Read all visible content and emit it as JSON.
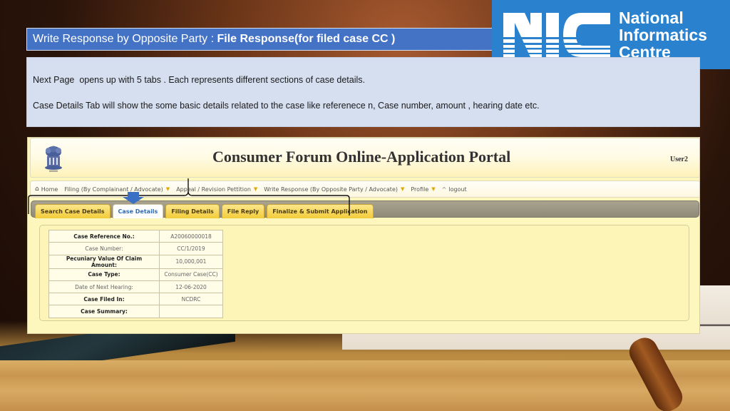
{
  "slide": {
    "title_prefix": "Write Response by Opposite Party : ",
    "title_bold": "File Response(for filed case CC )",
    "description": [
      "Next Page  opens up with 5 tabs . Each represents different sections of case details.",
      "Case Details Tab will show the some basic details related to the case like referenece n, Case number, amount , hearing date etc."
    ]
  },
  "logo": {
    "mark": "NIC",
    "lines": [
      "National",
      "Informatics",
      "Centre"
    ],
    "color": "#2a82cf"
  },
  "portal": {
    "title": "Consumer Forum Online-Application Portal",
    "user": "User2",
    "nav": [
      {
        "label": "Home",
        "icon": "home-icon",
        "dropdown": false
      },
      {
        "label": "Filing (By Complainant / Advocate)",
        "dropdown": true
      },
      {
        "label": "Appeal / Revision Pettition",
        "dropdown": true
      },
      {
        "label": "Write Response (By Opposite Party / Advocate)",
        "dropdown": true
      },
      {
        "label": "Profile",
        "dropdown": true
      },
      {
        "label": "logout",
        "icon": "logout-icon",
        "dropdown": false
      }
    ],
    "tabs": [
      {
        "label": "Search Case Details",
        "active": false
      },
      {
        "label": "Case Details",
        "active": true
      },
      {
        "label": "Filing Details",
        "active": false
      },
      {
        "label": "File Reply",
        "active": false
      },
      {
        "label": "Finalize & Submit Application",
        "active": false
      }
    ],
    "case_details": [
      {
        "label": "Case Reference No.:",
        "value": "A20060000018"
      },
      {
        "label": "Case Number:",
        "value": "CC/1/2019"
      },
      {
        "label": "Pecuniary Value Of Claim Amount:",
        "value": "10,000,001"
      },
      {
        "label": "Case Type:",
        "value": "Consumer Case(CC)"
      },
      {
        "label": "Date of Next Hearing:",
        "value": "12-06-2020"
      },
      {
        "label": "Case Filed In:",
        "value": "NCDRC"
      },
      {
        "label": "Case Summary:",
        "value": ""
      }
    ]
  },
  "colors": {
    "title_bar": "#4472c4",
    "desc_box": "#d6dff0",
    "tab_gold": "#f3cc3a",
    "active_tab_text": "#2c6bb5",
    "arrow": "#3a6fc4"
  }
}
